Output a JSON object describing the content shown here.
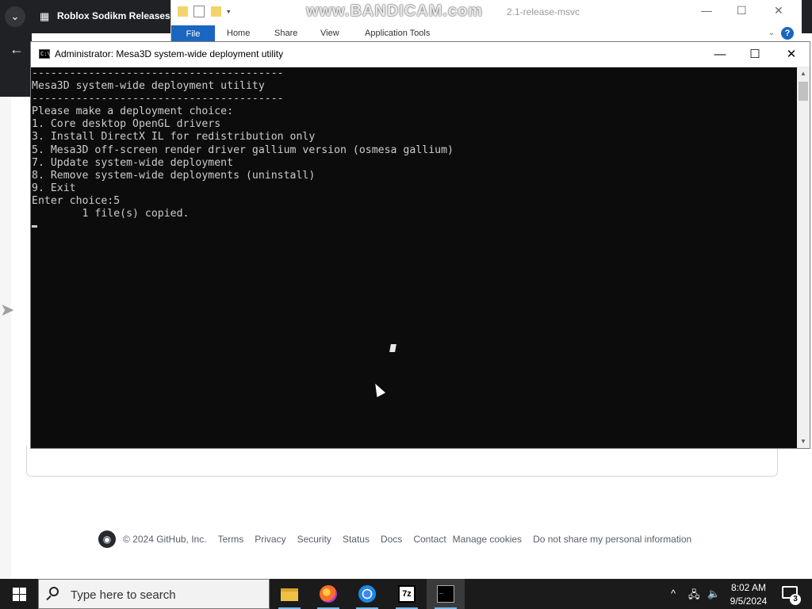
{
  "browser": {
    "tab_title": "Roblox Sodikm Releases :",
    "dropdown_icon": "chevron-down-icon",
    "back_icon": "back-arrow-icon"
  },
  "explorer": {
    "path_fragment": "2.1-release-msvc",
    "ribbon_tabs": [
      "File",
      "Home",
      "Share",
      "View",
      "Application Tools"
    ],
    "help_label": "?"
  },
  "watermark": "www.BANDICAM.com",
  "console": {
    "title": "Administrator:  Mesa3D system-wide deployment utility",
    "lines": [
      "----------------------------------------",
      "Mesa3D system-wide deployment utility",
      "----------------------------------------",
      "Please make a deployment choice:",
      "1. Core desktop OpenGL drivers",
      "3. Install DirectX IL for redistribution only",
      "5. Mesa3D off-screen render driver gallium version (osmesa gallium)",
      "7. Update system-wide deployment",
      "8. Remove system-wide deployments (uninstall)",
      "9. Exit",
      "",
      "Enter choice:5",
      "        1 file(s) copied."
    ],
    "controls": {
      "minimize": "—",
      "maximize": "☐",
      "close": "✕"
    }
  },
  "github_footer": {
    "copyright": "© 2024 GitHub, Inc.",
    "links": [
      "Terms",
      "Privacy",
      "Security",
      "Status",
      "Docs",
      "Contact",
      "Manage cookies",
      "Do not share my personal information"
    ]
  },
  "taskbar": {
    "search_placeholder": "Type here to search",
    "apps": [
      "file-explorer",
      "firefox",
      "chrome",
      "7-zip",
      "command-prompt"
    ],
    "seven_zip_label": "7z",
    "time": "8:02 AM",
    "date": "9/5/2024",
    "notifications_count": "3"
  }
}
